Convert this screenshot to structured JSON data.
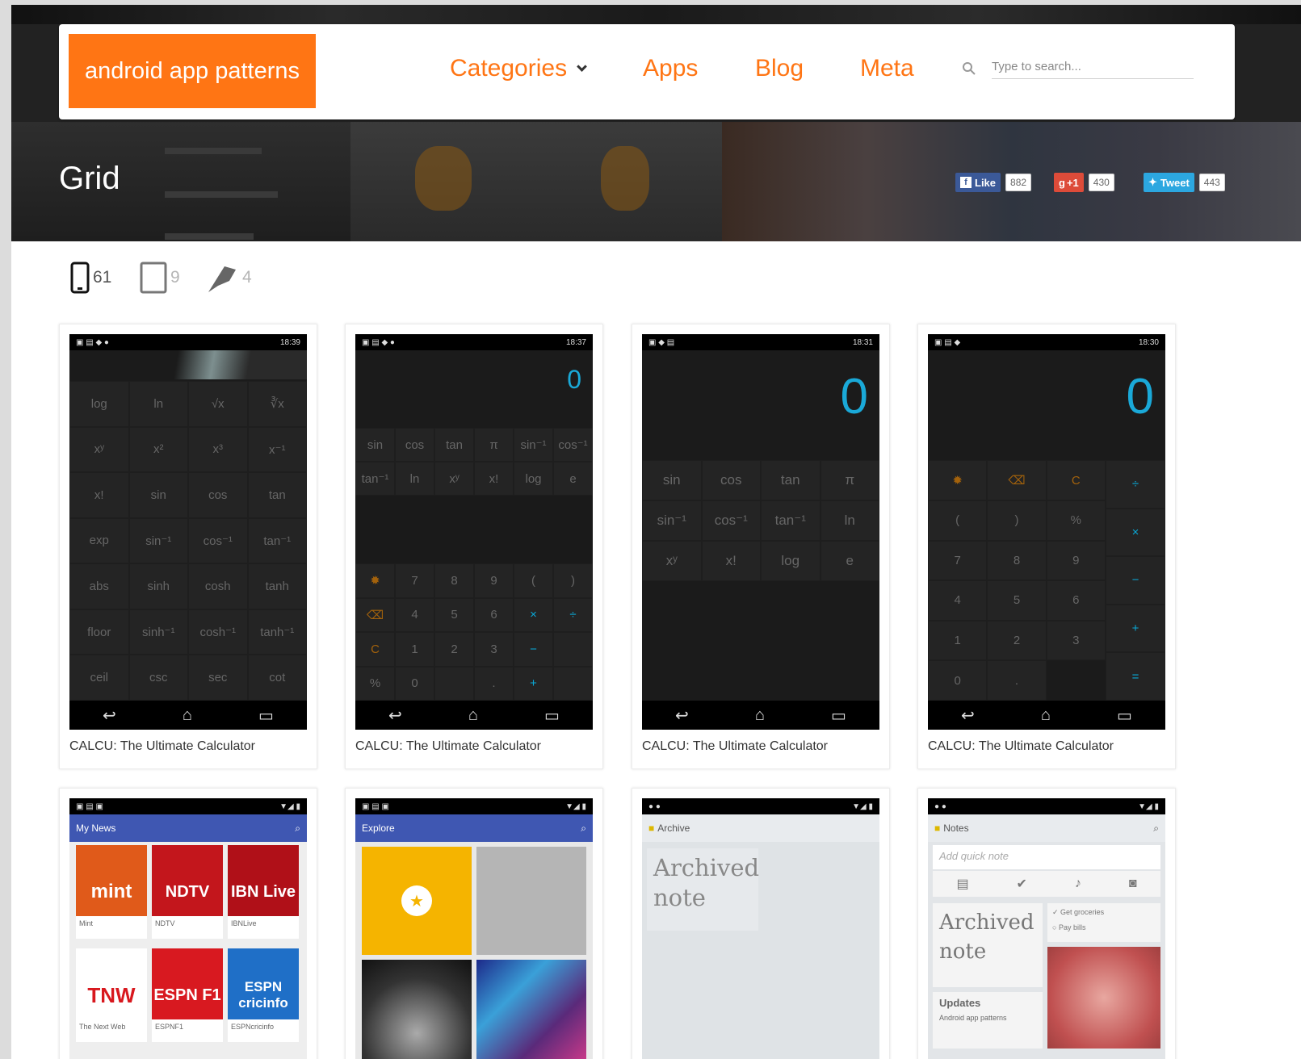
{
  "brand": {
    "logo_text": "android app patterns",
    "accent": "#ff7514"
  },
  "nav": {
    "categories": "Categories",
    "apps": "Apps",
    "blog": "Blog",
    "meta": "Meta",
    "search_placeholder": "Type to search..."
  },
  "page": {
    "title": "Grid"
  },
  "social": {
    "like_label": "Like",
    "like_count": "882",
    "plus_label": "+1",
    "plus_count": "430",
    "tweet_label": "Tweet",
    "tweet_count": "443"
  },
  "filters": {
    "phone_count": "61",
    "tablet_count": "9",
    "pin_count": "4"
  },
  "cards": [
    {
      "title": "CALCU: The Ultimate Calculator",
      "time": "18:39"
    },
    {
      "title": "CALCU: The Ultimate Calculator",
      "time": "18:37"
    },
    {
      "title": "CALCU: The Ultimate Calculator",
      "time": "18:31"
    },
    {
      "title": "CALCU: The Ultimate Calculator",
      "time": "18:30"
    }
  ],
  "calc1": {
    "keys": [
      "log",
      "ln",
      "√x",
      "∛x",
      "xʸ",
      "x²",
      "x³",
      "x⁻¹",
      "x!",
      "sin",
      "cos",
      "tan",
      "exp",
      "sin⁻¹",
      "cos⁻¹",
      "tan⁻¹",
      "abs",
      "sinh",
      "cosh",
      "tanh",
      "floor",
      "sinh⁻¹",
      "cosh⁻¹",
      "tanh⁻¹",
      "ceil",
      "csc",
      "sec",
      "cot"
    ]
  },
  "calc2": {
    "display": "0",
    "sci": [
      "sin",
      "cos",
      "tan",
      "π",
      "sin⁻¹",
      "cos⁻¹",
      "tan⁻¹",
      "ln",
      "xʸ",
      "x!",
      "log",
      "e"
    ],
    "pad": [
      "7",
      "8",
      "9",
      "(",
      ")",
      "4",
      "5",
      "6",
      "×",
      "÷",
      "1",
      "2",
      "3",
      "−",
      "%",
      "0",
      ".",
      "+"
    ]
  },
  "calc3": {
    "display": "0",
    "keys": [
      "sin",
      "cos",
      "tan",
      "π",
      "sin⁻¹",
      "cos⁻¹",
      "tan⁻¹",
      "ln",
      "xʸ",
      "x!",
      "log",
      "e"
    ]
  },
  "calc4": {
    "display": "0",
    "pad": [
      "(",
      ")",
      "%",
      "7",
      "8",
      "9",
      "4",
      "5",
      "6",
      "1",
      "2",
      "3",
      "0",
      "."
    ],
    "ops": [
      "÷",
      "×",
      "−",
      "+",
      "="
    ]
  },
  "row2": {
    "news_title": "My News",
    "news_tiles": [
      "mint",
      "NDTV",
      "IBN Live",
      "TNW",
      "ESPN F1",
      "ESPN cricinfo"
    ],
    "news_labels": [
      "Mint",
      "NDTV",
      "IBNLive",
      "The Next Web",
      "ESPNF1",
      "ESPNcricinfo"
    ],
    "explore_title": "Explore",
    "archive_title": "Archive",
    "archive_note": "Archived note",
    "notes_title": "Notes",
    "notes_placeholder": "Add quick note",
    "notes_note": "Archived note",
    "notes_list": [
      "Get groceries",
      "Pay bills"
    ],
    "notes_updates": "Updates",
    "notes_updates_sub": "Android app patterns"
  }
}
